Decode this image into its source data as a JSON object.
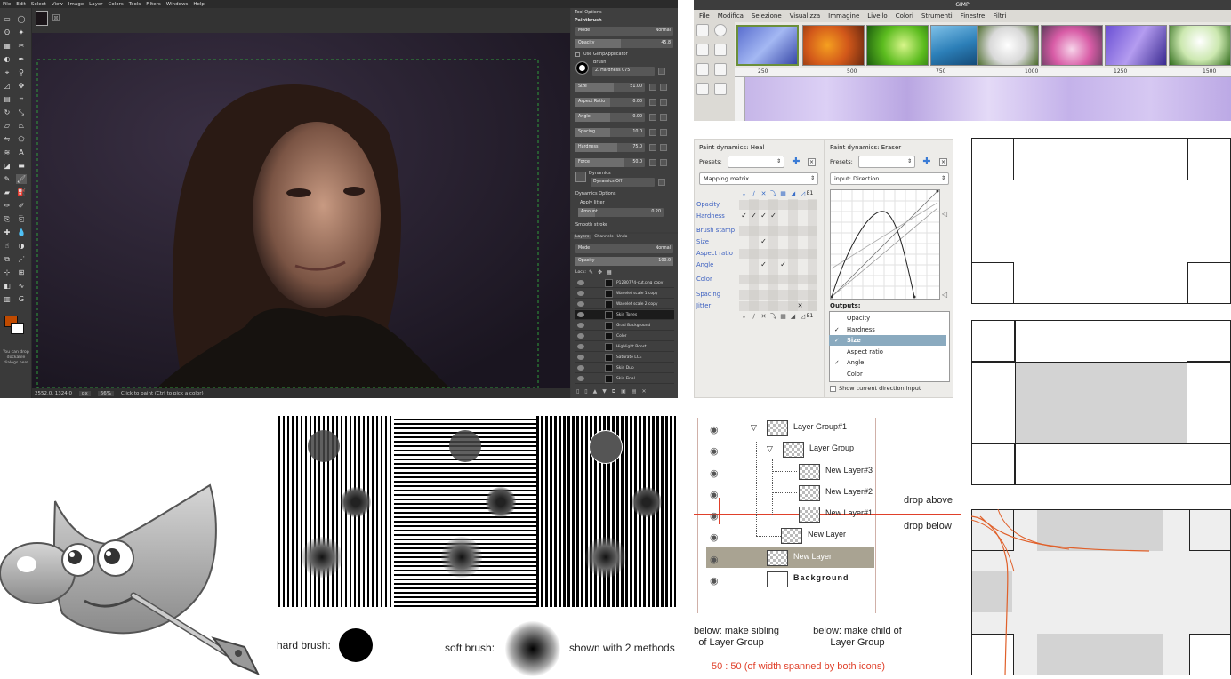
{
  "gimp_dark": {
    "menu": [
      "File",
      "Edit",
      "Select",
      "View",
      "Image",
      "Layer",
      "Colors",
      "Tools",
      "Filters",
      "Windows",
      "Help"
    ],
    "tool_options_title": "Tool Options",
    "tool_name": "Paintbrush",
    "mode_label": "Mode",
    "mode_value": "Normal",
    "opacity_label": "Opacity",
    "opacity_value": "45.8",
    "use_gimp_applicator": "Use GimpApplicator",
    "brush_label": "Brush",
    "brush_name": "2. Hardness 075",
    "rows": [
      {
        "label": "Size",
        "value": "51.00",
        "fill": 0.55
      },
      {
        "label": "Aspect Ratio",
        "value": "0.00",
        "fill": 0.5
      },
      {
        "label": "Angle",
        "value": "0.00",
        "fill": 0.5
      },
      {
        "label": "Spacing",
        "value": "10.0",
        "fill": 0.5
      },
      {
        "label": "Hardness",
        "value": "75.0",
        "fill": 0.6
      },
      {
        "label": "Force",
        "value": "50.0",
        "fill": 0.7
      }
    ],
    "dynamics_label": "Dynamics",
    "dynamics_value": "Dynamics Off",
    "dynamics_options": "Dynamics Options",
    "apply_jitter": "Apply Jitter",
    "amount_label": "Amount",
    "amount_value": "0.20",
    "smooth_stroke": "Smooth stroke",
    "layer_tabs": [
      "Layers",
      "Channels",
      "Undo"
    ],
    "layer_mode_label": "Mode",
    "layer_mode_value": "Normal",
    "layer_opacity_label": "Opacity",
    "layer_opacity_value": "100.0",
    "lock_label": "Lock:",
    "layers": [
      "P1280774-cut.png copy",
      "Wavelet scale 1 copy",
      "Wavelet scale 2 copy",
      "Skin Tones",
      "Grad Background",
      "Color",
      "Highlight Boost",
      "Saturate LCE",
      "Skin Dup",
      "Skin Final"
    ],
    "selected_layer": 3,
    "status_coords": "2552.0, 1324.0",
    "status_unit": "px",
    "status_zoom": "66%",
    "status_msg": "Click to paint (Ctrl to pick a color)",
    "dnd_hint": "You can drop dockable dialogs here",
    "fg_color": "#c04a00",
    "bg_color": "#ffffff"
  },
  "gimp_it": {
    "title": "GIMP",
    "menu": [
      "File",
      "Modifica",
      "Selezione",
      "Visualizza",
      "Immagine",
      "Livello",
      "Colori",
      "Strumenti",
      "Finestre",
      "Filtri"
    ],
    "ruler_ticks": [
      "250",
      "500",
      "750",
      "1000",
      "1250",
      "1500"
    ]
  },
  "pd_heal": {
    "title_prefix": "Paint dynamics:",
    "title_name": "Heal",
    "presets_label": "Presets:",
    "view_mode": "Mapping matrix",
    "col_e1": "E1",
    "rows": [
      "Opacity",
      "Hardness",
      "Brush stamp",
      "Size",
      "Aspect ratio",
      "Angle",
      "Color",
      "Spacing",
      "Jitter"
    ],
    "check_glyph": "✓"
  },
  "pd_eraser": {
    "title_prefix": "Paint dynamics:",
    "title_name": "Eraser",
    "presets_label": "Presets:",
    "input_value": "input: Direction",
    "outputs_label": "Outputs:",
    "outputs": [
      "Opacity",
      "Hardness",
      "Size",
      "Aspect ratio",
      "Angle",
      "Color"
    ],
    "checked": [
      false,
      true,
      true,
      false,
      true,
      false
    ],
    "selected_output": 2,
    "show_direction": "Show current direction input"
  },
  "brush_demo": {
    "hard_label": "hard brush:",
    "soft_label": "soft brush:",
    "methods_label": "shown with 2 methods"
  },
  "layer_tree": {
    "items": [
      {
        "name": "Layer Group#1",
        "indent": 0,
        "expander": true
      },
      {
        "name": "Layer Group",
        "indent": 1,
        "expander": true
      },
      {
        "name": "New Layer#3",
        "indent": 2,
        "expander": false
      },
      {
        "name": "New Layer#2",
        "indent": 2,
        "expander": false
      },
      {
        "name": "New Layer#1",
        "indent": 2,
        "expander": false
      },
      {
        "name": "New Layer",
        "indent": 1,
        "expander": false
      },
      {
        "name": "New Layer",
        "indent": 0,
        "expander": false
      },
      {
        "name": "Background",
        "indent": 0,
        "expander": false
      }
    ],
    "drop_above": "drop above",
    "drop_below": "drop below",
    "note_sibling_1": "below: make sibling",
    "note_sibling_2": "of Layer Group",
    "note_child_1": "below: make child of",
    "note_child_2": "Layer Group",
    "ratio_note": "50 : 50 (of width spanned by both icons)",
    "ratio_color": "#e0402a"
  }
}
